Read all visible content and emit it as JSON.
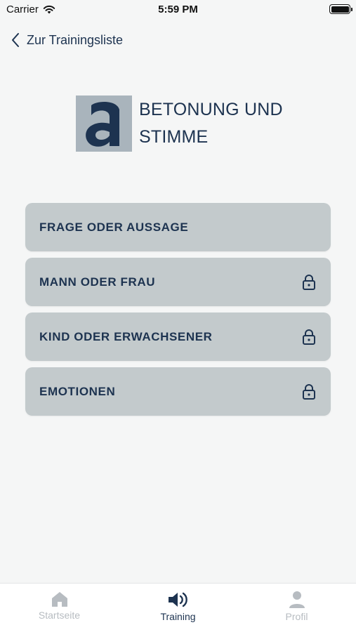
{
  "status_bar": {
    "carrier": "Carrier",
    "time": "5:59 PM"
  },
  "nav": {
    "back_label": "Zur Trainingsliste"
  },
  "header": {
    "logo_letter": "a",
    "title_line1": "BETONUNG UND",
    "title_line2": "STIMME"
  },
  "exercises": [
    {
      "label": "FRAGE ODER AUSSAGE",
      "locked": false
    },
    {
      "label": "MANN ODER FRAU",
      "locked": true
    },
    {
      "label": "KIND ODER ERWACHSENER",
      "locked": true
    },
    {
      "label": "EMOTIONEN",
      "locked": true
    }
  ],
  "tabbar": {
    "tabs": [
      {
        "label": "Startseite",
        "icon": "home-icon",
        "active": false
      },
      {
        "label": "Training",
        "icon": "speaker-icon",
        "active": true
      },
      {
        "label": "Profil",
        "icon": "person-icon",
        "active": false
      }
    ]
  },
  "colors": {
    "background": "#f5f6f6",
    "text_primary": "#1d3350",
    "card": "#c3cacc",
    "logo_bg": "#a9b4bc",
    "tab_inactive": "#b7bcc1"
  }
}
